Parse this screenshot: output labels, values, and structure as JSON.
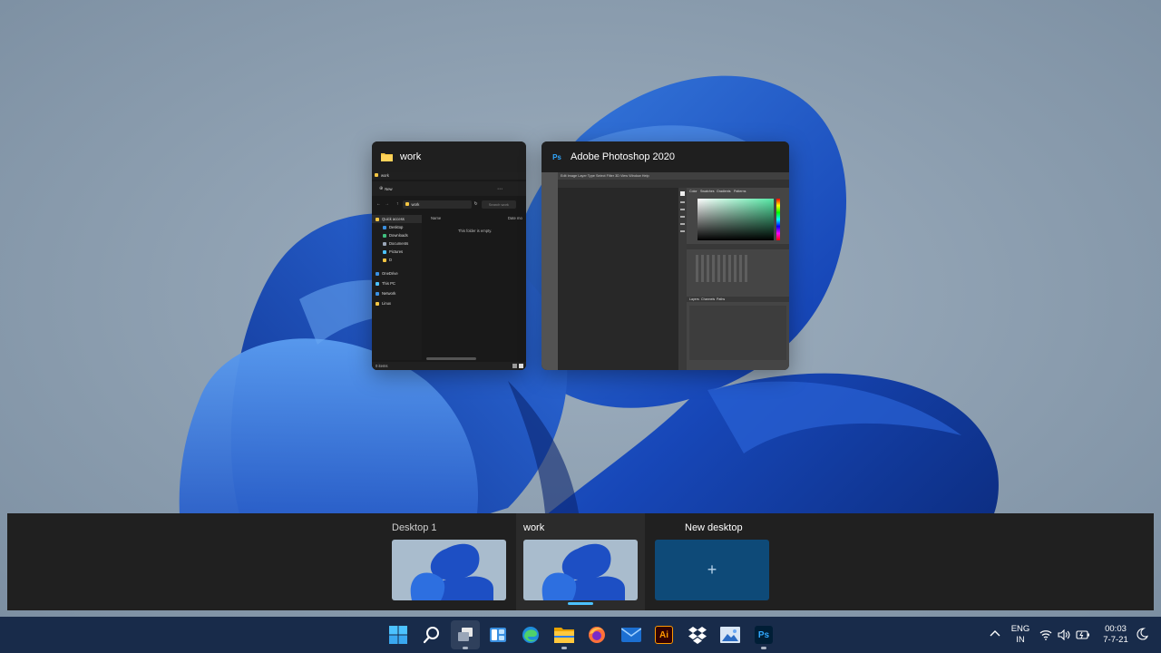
{
  "windows": {
    "explorer": {
      "title": "work",
      "breadcrumb": "work",
      "new_label": "New",
      "address_path": "work",
      "search_placeholder": "Search work",
      "nav_items": [
        "Quick access",
        "Desktop",
        "Downloads",
        "Documents",
        "Pictures",
        "D",
        "OneDrive",
        "This PC",
        "Network",
        "Linux"
      ],
      "col_name": "Name",
      "col_date": "Date mo",
      "empty_message": "This folder is empty.",
      "status": "0 items"
    },
    "photoshop": {
      "app_badge": "Ps",
      "title": "Adobe Photoshop 2020",
      "menu_text": "Edit  Image  Layer  Type  Select  Filter  3D  View  Window  Help",
      "panel_tabs": [
        "Color",
        "Swatches",
        "Gradients",
        "Patterns"
      ],
      "panel_tabs2": [
        "Layers",
        "Channels",
        "Paths"
      ]
    }
  },
  "desktops": [
    {
      "label": "Desktop 1"
    },
    {
      "label": "work"
    },
    {
      "label": "New desktop",
      "plus": "+"
    }
  ],
  "taskbar": {
    "icons": [
      "windows-start-icon",
      "search-icon",
      "task-view-icon",
      "widgets-icon",
      "edge-icon",
      "file-explorer-icon",
      "firefox-icon",
      "mail-icon",
      "illustrator-icon",
      "dropbox-icon",
      "photos-icon",
      "photoshop-icon"
    ],
    "illustrator_badge": "Ai",
    "photoshop_badge": "Ps",
    "lang_line1": "ENG",
    "lang_line2": "IN",
    "time": "00:03",
    "date": "7-7-21"
  },
  "colors": {
    "taskbar": "#182b4a",
    "accent": "#4cc2ff",
    "new_desktop": "#0e4a78"
  }
}
